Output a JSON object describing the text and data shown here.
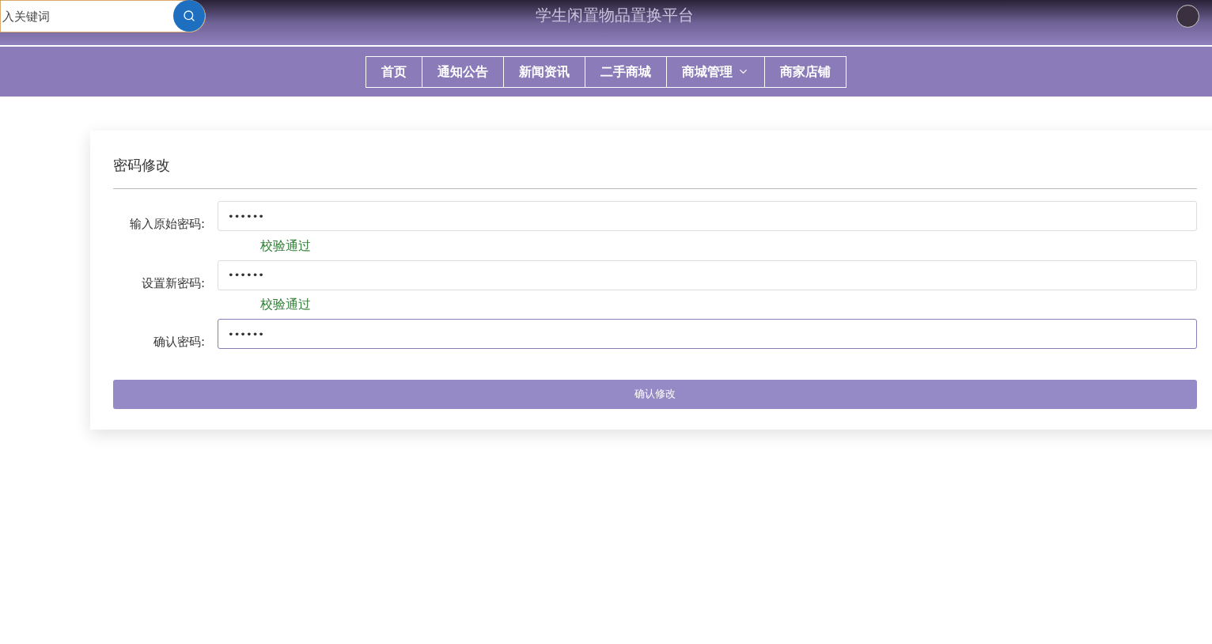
{
  "header": {
    "search": {
      "placeholder": "入关键词"
    },
    "title": "学生闲置物品置换平台"
  },
  "nav": [
    {
      "label": "首页",
      "dropdown": false
    },
    {
      "label": "通知公告",
      "dropdown": false
    },
    {
      "label": "新闻资讯",
      "dropdown": false
    },
    {
      "label": "二手商城",
      "dropdown": false
    },
    {
      "label": "商城管理",
      "dropdown": true
    },
    {
      "label": "商家店铺",
      "dropdown": false
    }
  ],
  "form": {
    "title": "密码修改",
    "fields": [
      {
        "label": "输入原始密码:",
        "value": "••••••",
        "focused": false,
        "hint": "校验通过"
      },
      {
        "label": "设置新密码:",
        "value": "••••••",
        "focused": false,
        "hint": "校验通过"
      },
      {
        "label": "确认密码:",
        "value": "••••••",
        "focused": true
      }
    ],
    "submit": "确认修改"
  }
}
